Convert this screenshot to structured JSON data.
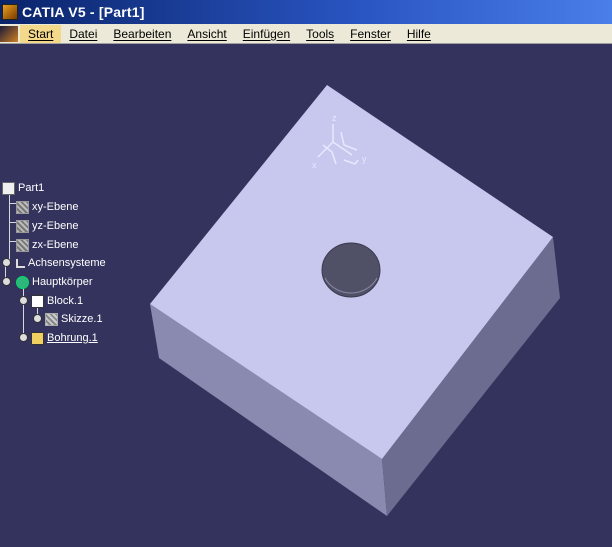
{
  "window": {
    "title": "CATIA V5 - [Part1]"
  },
  "menubar": {
    "items": [
      {
        "label": "Start",
        "active": true
      },
      {
        "label": "Datei"
      },
      {
        "label": "Bearbeiten"
      },
      {
        "label": "Ansicht"
      },
      {
        "label": "Einfügen"
      },
      {
        "label": "Tools"
      },
      {
        "label": "Fenster"
      },
      {
        "label": "Hilfe"
      }
    ]
  },
  "tree": {
    "root": "Part1",
    "planes": [
      "xy-Ebene",
      "yz-Ebene",
      "zx-Ebene"
    ],
    "axis_systems": "Achsensysteme",
    "main_body": "Hauptkörper",
    "pad": "Block.1",
    "sketch": "Skizze.1",
    "hole": "Bohrung.1"
  },
  "compass": {
    "x": "x",
    "y": "y",
    "z": "z"
  },
  "colors": {
    "background": "#33335e",
    "part_top": "#c8c8ee",
    "part_right": "#707096",
    "part_left": "#8a8ab0",
    "hole": "#505064"
  }
}
